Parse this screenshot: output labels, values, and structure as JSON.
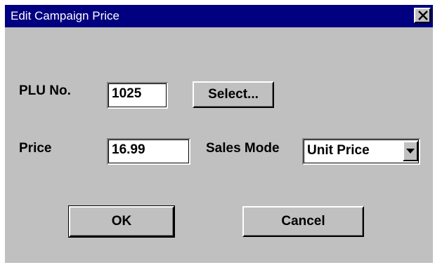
{
  "window": {
    "title": "Edit Campaign Price"
  },
  "form": {
    "plu_label": "PLU No.",
    "plu_value": "1025",
    "select_button": "Select...",
    "price_label": "Price",
    "price_value": "16.99",
    "sales_mode_label": "Sales Mode",
    "sales_mode_value": "Unit Price"
  },
  "buttons": {
    "ok": "OK",
    "cancel": "Cancel"
  },
  "icons": {
    "close": "close-icon",
    "dropdown": "chevron-down-icon"
  },
  "colors": {
    "title_bar": "#000080",
    "dialog_bg": "#c0c0c0"
  }
}
